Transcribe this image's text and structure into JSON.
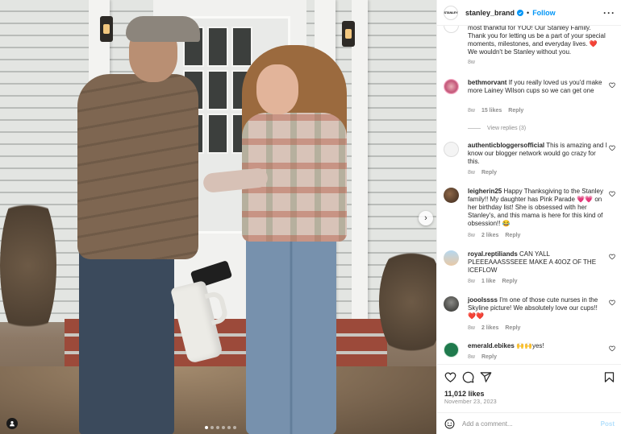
{
  "post": {
    "username": "stanley_brand",
    "brand_logo_text": "STANLEY",
    "separator": "•",
    "follow_label": "Follow",
    "more_label": "···",
    "likes": "11,012 likes",
    "date": "November 23, 2023",
    "comment_placeholder": "Add a comment...",
    "post_label": "Post",
    "carousel_slides": 6,
    "carousel_active_index": 0
  },
  "caption_tail": {
    "text": "most thankful for YOU! Our Stanley Family. Thank you for letting us be a part of your special moments, milestones, and everyday lives.",
    "heart": "❤️",
    "text2": "We wouldn't be Stanley without you.",
    "time": "8w"
  },
  "comments": [
    {
      "user": "bethmorvant",
      "text": "If you really loved us you'd make more Lainey Wilson cups so we can get one",
      "time": "8w",
      "likes": "15 likes",
      "reply": "Reply",
      "view_replies": "View replies (3)"
    },
    {
      "user": "authenticbloggersofficial",
      "text": "This is amazing and I know our blogger network would go crazy for this.",
      "time": "8w",
      "reply": "Reply"
    },
    {
      "user": "leigherin25",
      "text": "Happy Thanksgiving to the Stanley family!! My daughter has Pink Parade",
      "emoji1": "💗💗",
      "text2": "on her birthday list! She is obsessed with her Stanley's, and this mama is here for this kind of obsession!!",
      "emoji2": "😂",
      "time": "8w",
      "likes": "2 likes",
      "reply": "Reply"
    },
    {
      "user": "royal.reptiliands",
      "text": "CAN YALL PLEEEAAASSSEEE MAKE A 40OZ OF THE ICEFLOW",
      "time": "8w",
      "likes": "1 like",
      "reply": "Reply"
    },
    {
      "user": "jooolssss",
      "text": "I'm one of those cute nurses in the Skyline picture! We absolutely love our cups!!",
      "emoji1": "❤️❤️",
      "time": "8w",
      "likes": "2 likes",
      "reply": "Reply"
    },
    {
      "user": "emerald.ebikes",
      "emoji1": "🙌🙌",
      "text": "yes!",
      "time": "8w",
      "reply": "Reply"
    }
  ],
  "colors": {
    "link_blue": "#0095f6",
    "muted_gray": "#8e8e8e",
    "text_dark": "#262626",
    "post_disabled": "#b2dffc"
  },
  "icons": {
    "like": "heart-icon",
    "comment": "comment-icon",
    "share": "share-icon",
    "save": "bookmark-icon",
    "emoji": "emoji-icon",
    "next": "chevron-right-icon",
    "tag": "user-tag-icon",
    "more": "more-icon",
    "verified": "verified-badge-icon"
  }
}
